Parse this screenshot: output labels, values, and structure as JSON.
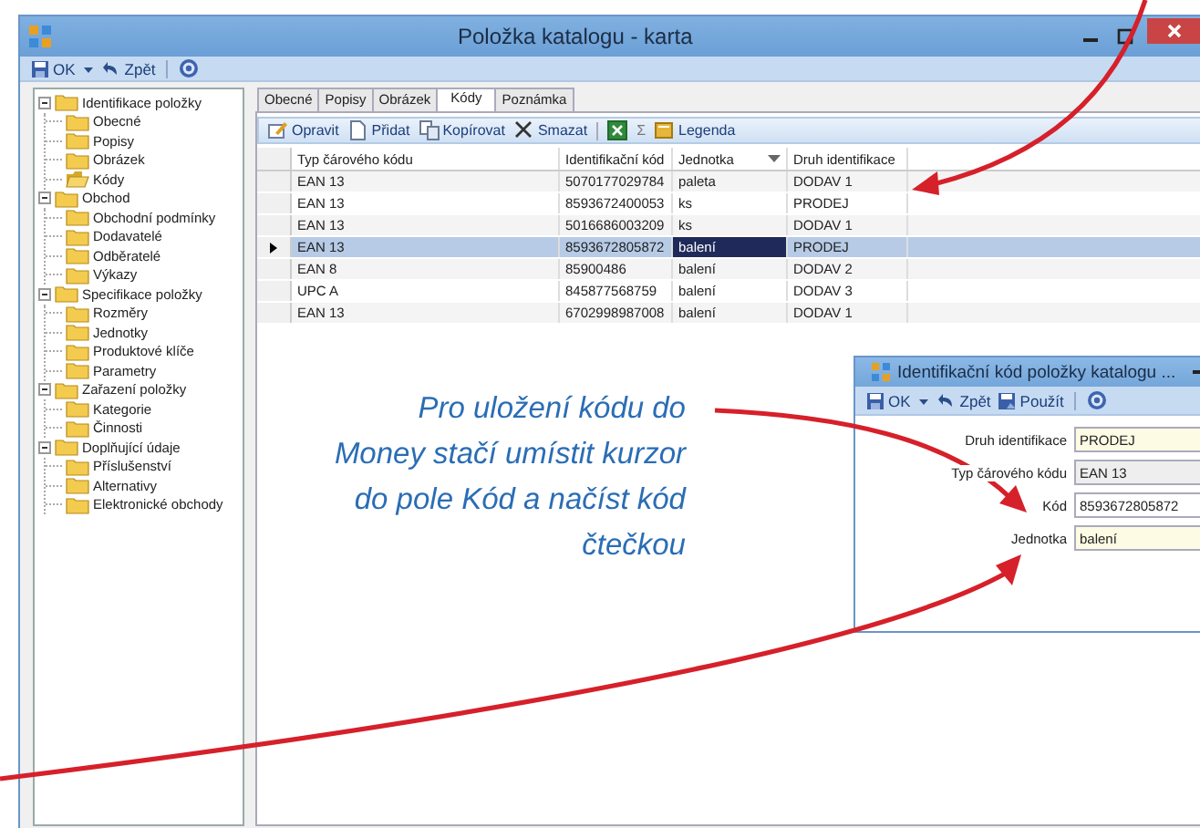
{
  "window": {
    "title": "Položka katalogu - karta"
  },
  "toolbar": [
    {
      "label": "OK",
      "kind": "save"
    },
    {
      "kind": "caret"
    },
    {
      "label": "Zpět",
      "kind": "undo"
    },
    {
      "kind": "help"
    }
  ],
  "tree": [
    {
      "label": "Identifikace položky",
      "expanded": true,
      "children": [
        {
          "label": "Obecné",
          "selected": false
        },
        {
          "label": "Popisy",
          "selected": false
        },
        {
          "label": "Obrázek",
          "selected": false
        },
        {
          "label": "Kódy",
          "selected": true
        }
      ]
    },
    {
      "label": "Obchod",
      "expanded": true,
      "children": [
        {
          "label": "Obchodní podmínky",
          "selected": false
        },
        {
          "label": "Dodavatelé",
          "selected": false
        },
        {
          "label": "Odběratelé",
          "selected": false
        },
        {
          "label": "Výkazy",
          "selected": false
        }
      ]
    },
    {
      "label": "Specifikace položky",
      "expanded": true,
      "children": [
        {
          "label": "Rozměry",
          "selected": false
        },
        {
          "label": "Jednotky",
          "selected": false
        },
        {
          "label": "Produktové klíče",
          "selected": false
        },
        {
          "label": "Parametry",
          "selected": false
        }
      ]
    },
    {
      "label": "Zařazení položky",
      "expanded": true,
      "children": [
        {
          "label": "Kategorie",
          "selected": false
        },
        {
          "label": "Činnosti",
          "selected": false
        }
      ]
    },
    {
      "label": "Doplňující údaje",
      "expanded": true,
      "children": [
        {
          "label": "Příslušenství",
          "selected": false
        },
        {
          "label": "Alternativy",
          "selected": false
        },
        {
          "label": "Elektronické obchody",
          "selected": false
        }
      ]
    }
  ],
  "tabs": [
    {
      "label": "Obecné",
      "selected": false
    },
    {
      "label": "Popisy",
      "selected": false
    },
    {
      "label": "Obrázek",
      "selected": false
    },
    {
      "label": "Kódy",
      "selected": true
    },
    {
      "label": "Poznámka",
      "selected": false
    }
  ],
  "grid_toolbar": [
    {
      "kind": "edit",
      "label": "Opravit"
    },
    {
      "kind": "new",
      "label": "Přidat"
    },
    {
      "kind": "copy",
      "label": "Kopírovat"
    },
    {
      "kind": "delete",
      "label": "Smazat"
    },
    {
      "kind": "separator"
    },
    {
      "kind": "excel"
    },
    {
      "kind": "text",
      "label": "Σ"
    },
    {
      "kind": "legend",
      "label": "Legenda"
    }
  ],
  "table": {
    "columns": [
      {
        "label": "Typ čárového kódu",
        "filter": false
      },
      {
        "label": "Identifikační kód",
        "filter": false
      },
      {
        "label": "Jednotka",
        "filter": true
      },
      {
        "label": "Druh identifikace",
        "filter": false
      }
    ],
    "rows": [
      {
        "selected": false,
        "cells": [
          {
            "text": "EAN 13",
            "focused": false
          },
          {
            "text": "5070177029784",
            "focused": false
          },
          {
            "text": "paleta",
            "focused": false
          },
          {
            "text": "DODAV 1",
            "focused": false
          }
        ]
      },
      {
        "selected": false,
        "cells": [
          {
            "text": "EAN 13",
            "focused": false
          },
          {
            "text": "8593672400053",
            "focused": false
          },
          {
            "text": "ks",
            "focused": false
          },
          {
            "text": "PRODEJ",
            "focused": false
          }
        ]
      },
      {
        "selected": false,
        "cells": [
          {
            "text": "EAN 13",
            "focused": false
          },
          {
            "text": "5016686003209",
            "focused": false
          },
          {
            "text": "ks",
            "focused": false
          },
          {
            "text": "DODAV 1",
            "focused": false
          }
        ]
      },
      {
        "selected": true,
        "cells": [
          {
            "text": "EAN 13",
            "focused": false
          },
          {
            "text": "8593672805872",
            "focused": false
          },
          {
            "text": "balení",
            "focused": true
          },
          {
            "text": "PRODEJ",
            "focused": false
          }
        ]
      },
      {
        "selected": false,
        "cells": [
          {
            "text": "EAN 8",
            "focused": false
          },
          {
            "text": "85900486",
            "focused": false
          },
          {
            "text": "balení",
            "focused": false
          },
          {
            "text": "DODAV 2",
            "focused": false
          }
        ]
      },
      {
        "selected": false,
        "cells": [
          {
            "text": "UPC A",
            "focused": false
          },
          {
            "text": "845877568759",
            "focused": false
          },
          {
            "text": "balení",
            "focused": false
          },
          {
            "text": "DODAV 3",
            "focused": false
          }
        ]
      },
      {
        "selected": false,
        "cells": [
          {
            "text": "EAN 13",
            "focused": false
          },
          {
            "text": "6702998987008",
            "focused": false
          },
          {
            "text": "balení",
            "focused": false
          },
          {
            "text": "DODAV 1",
            "focused": false
          }
        ]
      }
    ]
  },
  "annotation": "Pro uložení kódu do\nMoney stačí umístit kurzor\ndo pole Kód a načíst kód\nčtečkou",
  "dialog": {
    "title": "Identifikační kód položky katalogu ...",
    "toolbar": [
      {
        "label": "OK",
        "kind": "save"
      },
      {
        "kind": "caret"
      },
      {
        "label": "Zpět",
        "kind": "undo"
      },
      {
        "label": "Použít",
        "kind": "apply"
      },
      {
        "kind": "help"
      }
    ],
    "fields": [
      {
        "label": "Druh identifikace",
        "value": "PRODEJ",
        "kind": "required"
      },
      {
        "label": "Typ čárového kódu",
        "value": "EAN 13",
        "kind": "readonly"
      },
      {
        "label": "Kód",
        "value": "8593672805872",
        "kind": "text"
      },
      {
        "label": "Jednotka",
        "value": "balení",
        "kind": "required"
      }
    ]
  }
}
